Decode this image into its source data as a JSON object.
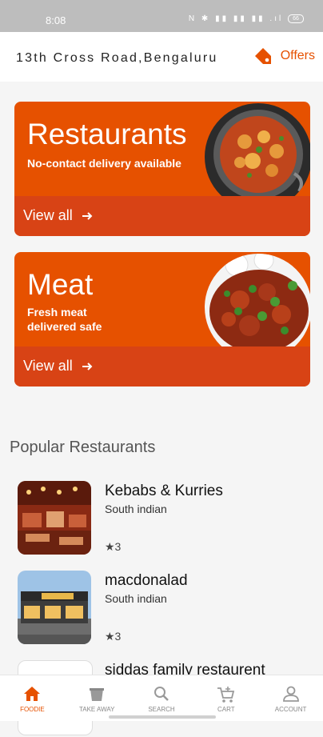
{
  "status_bar": {
    "time": "8:08",
    "icons": "N ✱ ▮▮ ▮▮ ▮▮ .ıl",
    "battery": "66"
  },
  "header": {
    "address": "13th Cross Road,Bengaluru",
    "offers_label": "Offers"
  },
  "promos": [
    {
      "title": "Restaurants",
      "subtitle": "No-contact delivery available",
      "cta": "View all"
    },
    {
      "title": "Meat",
      "subtitle": "Fresh meat\ndelivered safe",
      "cta": "View all"
    }
  ],
  "popular": {
    "title": "Popular Restaurants",
    "items": [
      {
        "name": "Kebabs & Kurries",
        "cuisine": "South indian",
        "rating": "★3"
      },
      {
        "name": "macdonalad",
        "cuisine": "South indian",
        "rating": "★3"
      },
      {
        "name": "siddas family restaurent",
        "cuisine": "",
        "rating": ""
      }
    ]
  },
  "nav": [
    {
      "label": "FOODIE",
      "icon": "home-icon",
      "active": true
    },
    {
      "label": "TAKE AWAY",
      "icon": "takeaway-bag-icon",
      "active": false
    },
    {
      "label": "SEARCH",
      "icon": "search-icon",
      "active": false
    },
    {
      "label": "CART",
      "icon": "cart-icon",
      "active": false
    },
    {
      "label": "ACCOUNT",
      "icon": "account-icon",
      "active": false
    }
  ],
  "colors": {
    "accent": "#e65100",
    "accent_dark": "#d84315",
    "background": "#f5f5f5"
  }
}
